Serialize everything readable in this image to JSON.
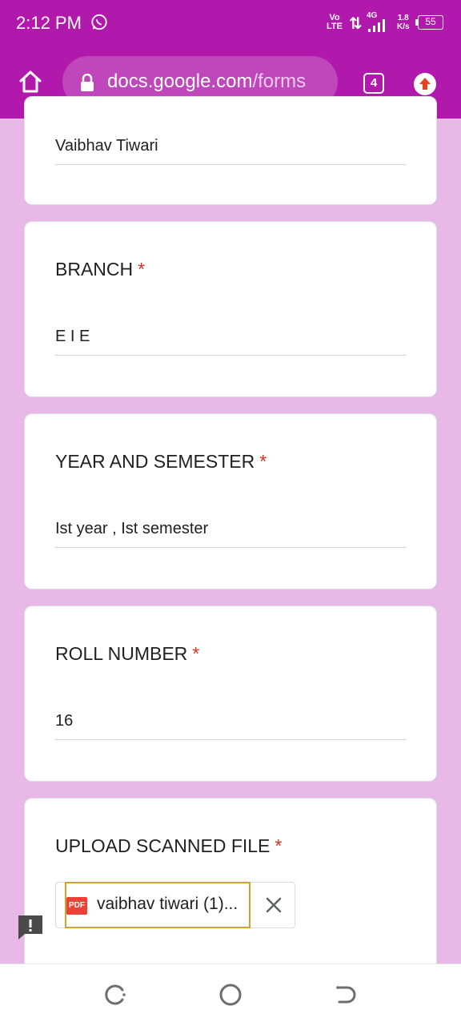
{
  "status_bar": {
    "time": "2:12 PM",
    "network_top": "Vo",
    "network_bottom": "LTE",
    "network_gen": "4G",
    "speed_top": "1.8",
    "speed_bottom": "K/s",
    "battery": "55"
  },
  "browser": {
    "url_host": "docs.google.com",
    "url_path": "/forms",
    "tab_count": "4",
    "theme_color": "#b019ab"
  },
  "form": {
    "name_answer": "Vaibhav Tiwari",
    "fields": [
      {
        "label": "BRANCH",
        "required": "*",
        "value": "E I E"
      },
      {
        "label": "YEAR AND SEMESTER",
        "required": "*",
        "value": "Ist year , Ist semester"
      },
      {
        "label": "ROLL NUMBER",
        "required": "*",
        "value": "16"
      }
    ],
    "upload": {
      "label": "UPLOAD SCANNED FILE",
      "required": "*",
      "file_type": "PDF",
      "file_name": "vaibhav tiwari (1)..."
    },
    "required_color": "#d93025",
    "background_color": "#e8b8e6"
  },
  "icons": {
    "home": "home-icon",
    "lock": "lock-icon",
    "update": "update-arrow-icon",
    "remove_file": "close-icon",
    "feedback": "feedback-icon",
    "recents": "recents-icon",
    "home_nav": "circle-home-icon",
    "back": "back-icon"
  }
}
